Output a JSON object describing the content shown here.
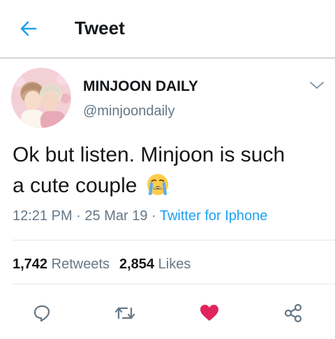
{
  "header": {
    "back_icon": "arrow-left-icon",
    "title": "Tweet"
  },
  "tweet": {
    "display_name": "MINJOON DAILY",
    "handle": "@minjoondaily",
    "text_line1": "Ok but listen. Minjoon is such",
    "text_line2": "a cute couple",
    "emoji": "loudly-crying-face",
    "time": "12:21 PM",
    "separator": " · ",
    "date": "25 Mar 19",
    "source": "Twitter for Iphone",
    "retweets_count": "1,742",
    "retweets_label": "Retweets",
    "likes_count": "2,854",
    "likes_label": "Likes",
    "liked": true
  },
  "actions": [
    {
      "name": "reply",
      "icon": "speech-bubble-icon"
    },
    {
      "name": "retweet",
      "icon": "retweet-icon"
    },
    {
      "name": "like",
      "icon": "heart-icon"
    },
    {
      "name": "share",
      "icon": "share-icon"
    }
  ],
  "colors": {
    "accent": "#1da1f2",
    "text": "#14171a",
    "secondary": "#657786",
    "like": "#e0245e",
    "divider": "#e1e8ed"
  }
}
